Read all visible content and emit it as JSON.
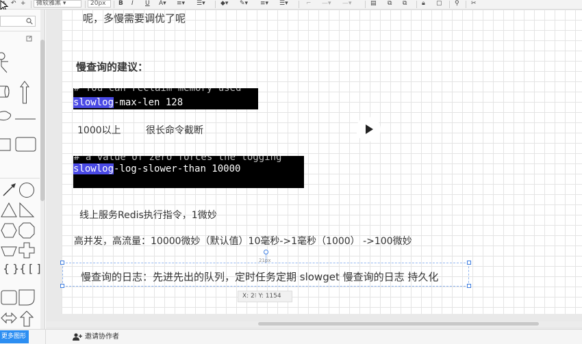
{
  "toolbar": {
    "font_family": "微软雅黑",
    "font_size": "20px",
    "bold": "B",
    "italic": "I",
    "underline": "U"
  },
  "sidebar": {
    "search_placeholder": ""
  },
  "canvas": {
    "line_top": "呢，多慢需要调优了呢",
    "heading": "慢查询的建议：",
    "term1": {
      "faded": "# You can reclaim memory used",
      "highlight": "slowlog",
      "rest": "-max-len 128"
    },
    "note1a": "1000以上",
    "note1b": "很长命令截断",
    "term2": {
      "faded": "# a value of zero forces the logging",
      "highlight": "slowlog",
      "rest": "-log-slower-than 10000"
    },
    "note2": "线上服务Redis执行指令，1微妙",
    "note3": "高并发，高流量：10000微妙（默认值）10毫秒->1毫秒（1000） ->100微妙",
    "selected_text": "慢查询的日志：先进先出的队列，定时任务定期 slowget 慢查询的日志 持久化",
    "size_label": "21px",
    "coord_tooltip": "X: 2⁝  Y: 1154"
  },
  "bottombar": {
    "more_shapes": "更多图形",
    "invite": "邀请协作者"
  },
  "colors": {
    "accent": "#2c8ef2",
    "selection": "#3a7be0",
    "highlight": "#4a4ae6"
  }
}
